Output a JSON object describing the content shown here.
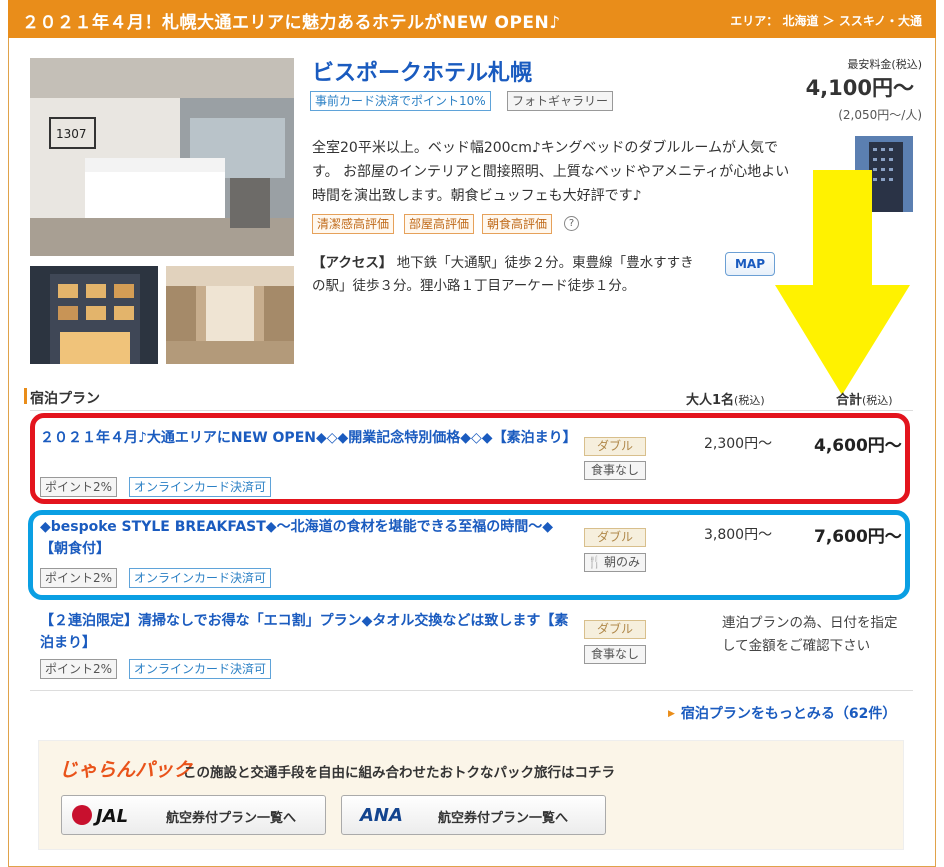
{
  "topbar": {
    "title": "２０２１年４月！札幌大通エリアに魅力あるホテルがNEW OPEN♪",
    "area": "エリア： 北海道 ＞ ススキノ・大通"
  },
  "hotel": {
    "name": "ビスポークホテル札幌",
    "tags": [
      "事前カード決済でポイント10%",
      "フォトギャラリー"
    ],
    "price_label": "最安料金(税込)",
    "price": "4,100円〜",
    "price_per": "(2,050円〜/人)",
    "description": "全室20平米以上。ベッド幅200cm♪キングベッドのダブルルームが人気です。 お部屋のインテリアと間接照明、上質なベッドやアメニティが心地よい時間を演出致します。朝食ビュッフェも大好評です♪",
    "ratings": [
      "清潔感高評価",
      "部屋高評価",
      "朝食高評価"
    ],
    "access_label": "【アクセス】",
    "access_text": "地下鉄「大通駅」徒歩２分。東豊線「豊水すすきの駅」徒歩３分。狸小路１丁目アーケード徒歩１分。",
    "map": "MAP",
    "help": "?"
  },
  "plans": {
    "heading": "宿泊プラン",
    "col_adult": "大人1名",
    "col_total": "合計",
    "tax": "(税込)",
    "items": [
      {
        "title": "２０２１年４月♪大通エリアにNEW OPEN◆◇◆開業記念特別価格◆◇◆【素泊まり】",
        "badges": [
          "ポイント2%",
          "オンラインカード決済可"
        ],
        "room": "ダブル",
        "meal": "食事なし",
        "adult": "2,300円〜",
        "total": "4,600円〜"
      },
      {
        "title": "◆bespoke STYLE BREAKFAST◆〜北海道の食材を堪能できる至福の時間〜◆【朝食付】",
        "badges": [
          "ポイント2%",
          "オンラインカード決済可"
        ],
        "room": "ダブル",
        "meal": "朝のみ",
        "adult": "3,800円〜",
        "total": "7,600円〜"
      },
      {
        "title": "【２連泊限定】清掃なしでお得な「エコ割」プラン◆タオル交換などは致します【素泊まり】",
        "badges": [
          "ポイント2%",
          "オンラインカード決済可"
        ],
        "room": "ダブル",
        "meal": "食事なし",
        "note": "連泊プランの為、日付を指定して金額をご確認下さい"
      }
    ],
    "more": "宿泊プランをもっとみる（62件）"
  },
  "pack": {
    "logo": "じゃらんパック",
    "text": "この施設と交通手段を自由に組み合わせたおトクなパック旅行はコチラ",
    "jal_logo": "JAL",
    "jal_label": "航空券付プラン一覧へ",
    "ana_logo": "ANA",
    "ana_label": "航空券付プラン一覧へ"
  },
  "colors": {
    "accent": "#e98d1a",
    "link": "#1a5bbf",
    "red_highlight": "#e3141d",
    "blue_highlight": "#0a9fe3",
    "arrow": "#fff200"
  },
  "icons": [
    "chevron-right-icon",
    "help-icon",
    "fork-knife-icon",
    "down-arrow-icon"
  ]
}
